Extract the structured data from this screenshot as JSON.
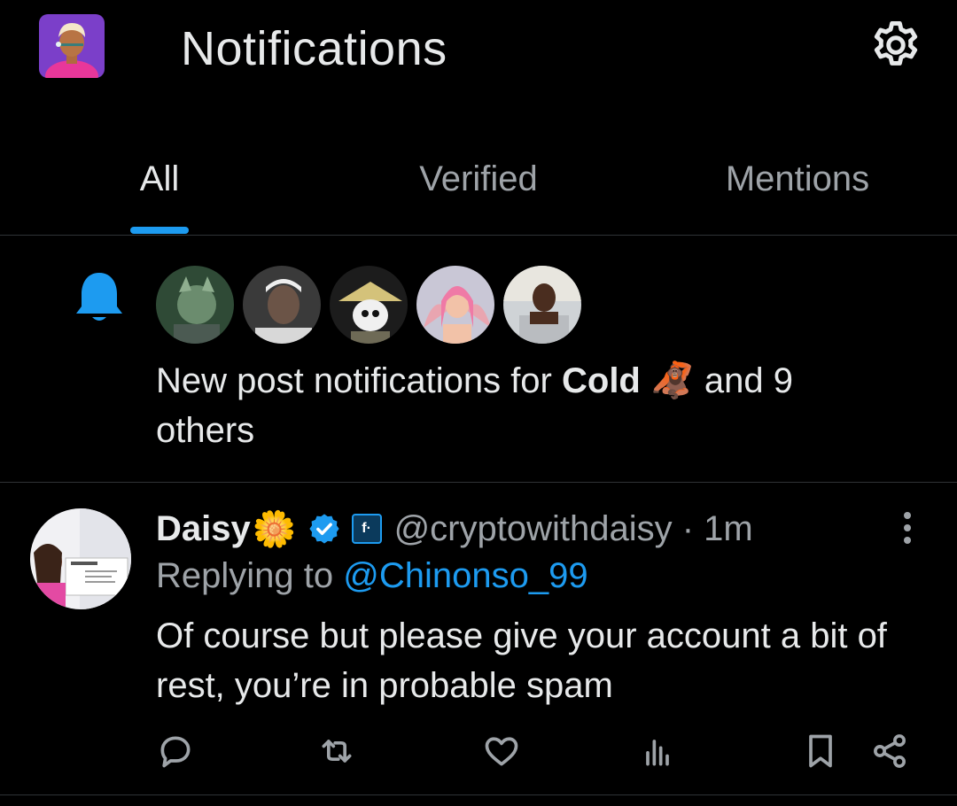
{
  "header": {
    "title": "Notifications",
    "settings_icon": "gear-icon",
    "avatar_icon": "profile-avatar"
  },
  "tabs": [
    {
      "label": "All",
      "active": true
    },
    {
      "label": "Verified",
      "active": false
    },
    {
      "label": "Mentions",
      "active": false
    }
  ],
  "notification": {
    "icon": "bell-icon",
    "text_prefix": "New post notifications for ",
    "name": "Cold",
    "emoji": "🦧",
    "text_suffix": " and 9",
    "text_line2": "others",
    "avatar_count": 5
  },
  "post": {
    "name": "Daisy",
    "name_emoji": "🌼",
    "badge_text": "f·",
    "handle": "@cryptowithdaisy",
    "separator": " · ",
    "time": "1m",
    "replying_prefix": "Replying to ",
    "replying_to": "@Chinonso_99",
    "body": "Of course but please give your account a bit of rest, you’re in probable spam",
    "actions": [
      "reply-icon",
      "repost-icon",
      "like-icon",
      "views-icon",
      "bookmark-icon",
      "share-icon"
    ]
  },
  "colors": {
    "background": "#000000",
    "text": "#e7e9ea",
    "muted": "#9ea3a8",
    "accent": "#1d9bf0",
    "divider": "#2f3336"
  }
}
